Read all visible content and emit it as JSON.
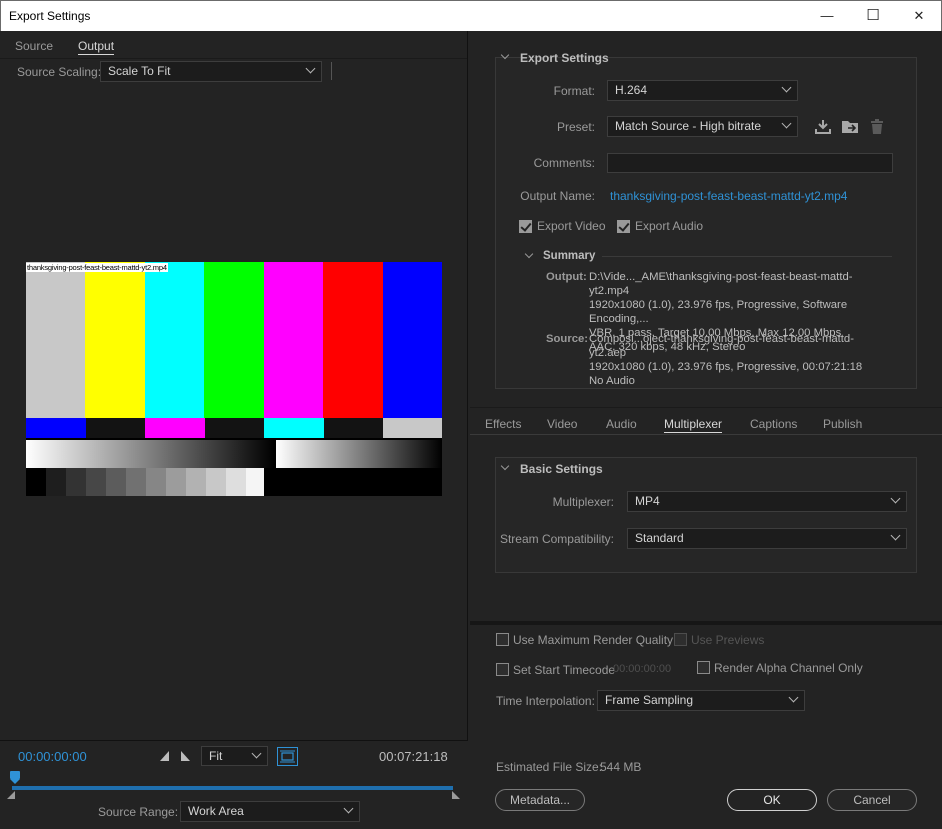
{
  "window": {
    "title": "Export Settings",
    "minimize": "—",
    "maximize": "☐",
    "close": "✕"
  },
  "left": {
    "tabs": [
      "Source",
      "Output"
    ],
    "source_scaling": {
      "label": "Source Scaling:",
      "value": "Scale To Fit"
    },
    "preview_filename": "thanksgiving-post-feast-beast-mattd-yt2.mp4",
    "timecode_start": "00:00:00:00",
    "fit": "Fit",
    "timecode_end": "00:07:21:18",
    "source_range": {
      "label": "Source Range:",
      "value": "Work Area"
    }
  },
  "export_settings": {
    "header": "Export Settings",
    "format": {
      "label": "Format:",
      "value": "H.264"
    },
    "preset": {
      "label": "Preset:",
      "value": "Match Source - High bitrate"
    },
    "comments": {
      "label": "Comments:",
      "value": ""
    },
    "output_name": {
      "label": "Output Name:",
      "value": "thanksgiving-post-feast-beast-mattd-yt2.mp4"
    },
    "export_video": "Export Video",
    "export_audio": "Export Audio",
    "summary": {
      "header": "Summary",
      "output_label": "Output:",
      "output_lines": [
        "D:\\Vide..._AME\\thanksgiving-post-feast-beast-mattd-yt2.mp4",
        "1920x1080 (1.0), 23.976 fps, Progressive, Software Encoding,...",
        "VBR, 1 pass, Target 10.00 Mbps, Max 12.00 Mbps",
        "AAC, 320 kbps, 48 kHz, Stereo"
      ],
      "source_label": "Source:",
      "source_lines": [
        "Composi...oject-thanksgiving-post-feast-beast-mattd-yt2.aep",
        "1920x1080 (1.0), 23.976 fps, Progressive, 00:07:21:18",
        "No Audio"
      ]
    }
  },
  "tabs": [
    "Effects",
    "Video",
    "Audio",
    "Multiplexer",
    "Captions",
    "Publish"
  ],
  "basic_settings": {
    "header": "Basic Settings",
    "multiplexer": {
      "label": "Multiplexer:",
      "value": "MP4"
    },
    "stream": {
      "label": "Stream Compatibility:",
      "value": "Standard"
    }
  },
  "options": {
    "max_render": "Use Maximum Render Quality",
    "use_previews": "Use Previews",
    "set_start_tc": "Set Start Timecode",
    "start_tc_value": "00:00:00:00",
    "render_alpha": "Render Alpha Channel Only",
    "time_interp": {
      "label": "Time Interpolation:",
      "value": "Frame Sampling"
    },
    "file_size_label": "Estimated File Size:",
    "file_size_value": "544 MB"
  },
  "buttons": {
    "metadata": "Metadata...",
    "ok": "OK",
    "cancel": "Cancel"
  },
  "colors": {
    "accent": "#2f92d6"
  }
}
